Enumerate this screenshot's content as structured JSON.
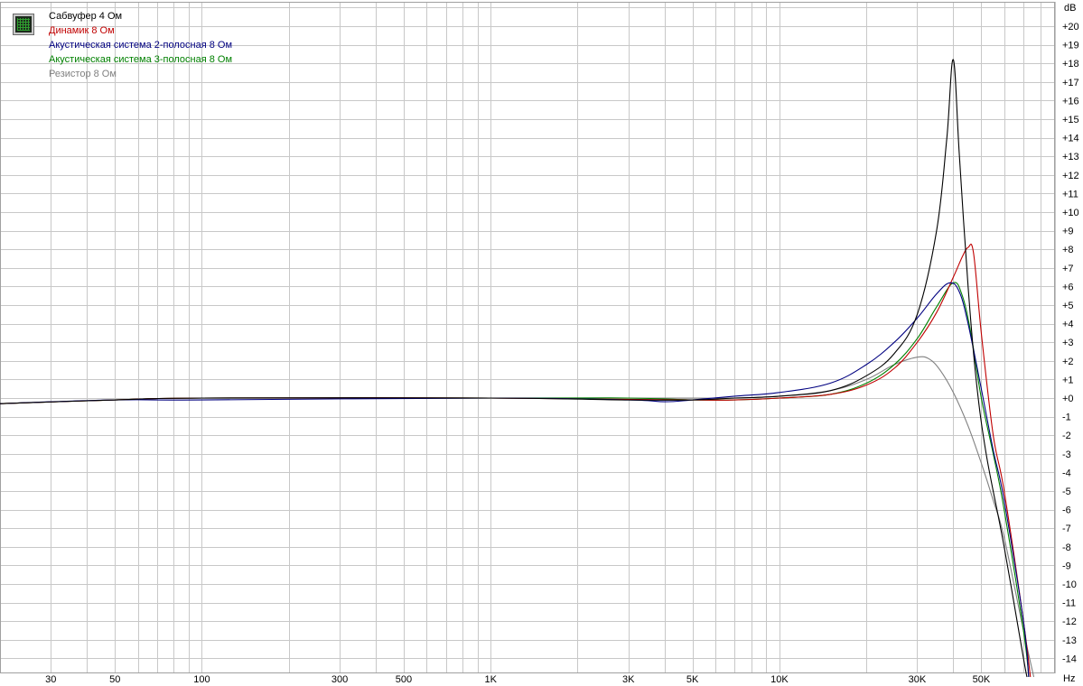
{
  "chart_data": {
    "type": "line",
    "title": "",
    "xlabel": "Hz",
    "ylabel": "dB",
    "x_scale": "log",
    "xlim": [
      20,
      90000
    ],
    "ylim": [
      -15,
      21
    ],
    "grid": true,
    "legend_position": "top-left",
    "x_ticks": [
      "30",
      "50",
      "100",
      "300",
      "500",
      "1K",
      "3K",
      "5K",
      "10K",
      "30K",
      "50K"
    ],
    "y_ticks": [
      "+20",
      "+19",
      "+18",
      "+17",
      "+16",
      "+15",
      "+14",
      "+13",
      "+12",
      "+11",
      "+10",
      "+9",
      "+8",
      "+7",
      "+6",
      "+5",
      "+4",
      "+3",
      "+2",
      "+1",
      "+0",
      "-1",
      "-2",
      "-3",
      "-4",
      "-5",
      "-6",
      "-7",
      "-8",
      "-9",
      "-10",
      "-11",
      "-12",
      "-13",
      "-14"
    ],
    "series": [
      {
        "name": "Сабвуфер 4 Ом",
        "color": "#000000",
        "points": [
          [
            20,
            -0.3
          ],
          [
            50,
            -0.1
          ],
          [
            100,
            0.0
          ],
          [
            1000,
            0.0
          ],
          [
            3000,
            -0.1
          ],
          [
            5000,
            -0.1
          ],
          [
            7000,
            0.0
          ],
          [
            10000,
            0.1
          ],
          [
            15000,
            0.4
          ],
          [
            20000,
            1.2
          ],
          [
            25000,
            2.4
          ],
          [
            30000,
            4.5
          ],
          [
            35000,
            9.0
          ],
          [
            38000,
            14.0
          ],
          [
            40000,
            18.2
          ],
          [
            42000,
            13.0
          ],
          [
            45000,
            6.0
          ],
          [
            48000,
            1.0
          ],
          [
            52000,
            -3.0
          ],
          [
            60000,
            -8.0
          ],
          [
            70000,
            -14.0
          ],
          [
            72000,
            -15.0
          ]
        ]
      },
      {
        "name": "Динамик 8 Ом",
        "color": "#c00000",
        "points": [
          [
            20,
            -0.3
          ],
          [
            50,
            -0.1
          ],
          [
            100,
            0.0
          ],
          [
            1000,
            0.0
          ],
          [
            5000,
            -0.1
          ],
          [
            7000,
            -0.1
          ],
          [
            10000,
            0.0
          ],
          [
            15000,
            0.2
          ],
          [
            20000,
            0.7
          ],
          [
            25000,
            1.6
          ],
          [
            30000,
            3.0
          ],
          [
            35000,
            4.6
          ],
          [
            40000,
            6.5
          ],
          [
            43000,
            7.6
          ],
          [
            45000,
            8.1
          ],
          [
            47000,
            7.8
          ],
          [
            50000,
            3.5
          ],
          [
            55000,
            -2.0
          ],
          [
            60000,
            -5.0
          ],
          [
            70000,
            -12.0
          ],
          [
            74000,
            -15.0
          ]
        ]
      },
      {
        "name": "Акустическая система 2-полосная 8 Ом",
        "color": "#000080",
        "points": [
          [
            20,
            -0.3
          ],
          [
            50,
            -0.1
          ],
          [
            100,
            -0.1
          ],
          [
            1000,
            0.0
          ],
          [
            3000,
            -0.1
          ],
          [
            4000,
            -0.2
          ],
          [
            5000,
            -0.1
          ],
          [
            7000,
            0.1
          ],
          [
            10000,
            0.3
          ],
          [
            15000,
            0.8
          ],
          [
            20000,
            1.8
          ],
          [
            25000,
            3.0
          ],
          [
            30000,
            4.3
          ],
          [
            35000,
            5.6
          ],
          [
            39000,
            6.2
          ],
          [
            42000,
            5.7
          ],
          [
            45000,
            4.0
          ],
          [
            50000,
            0.5
          ],
          [
            55000,
            -2.8
          ],
          [
            60000,
            -5.5
          ],
          [
            70000,
            -12.0
          ],
          [
            73000,
            -15.0
          ]
        ]
      },
      {
        "name": "Акустическая система 3-полосная 8 Ом",
        "color": "#008000",
        "points": [
          [
            20,
            -0.3
          ],
          [
            50,
            -0.1
          ],
          [
            100,
            0.0
          ],
          [
            1000,
            0.0
          ],
          [
            3000,
            0.0
          ],
          [
            5000,
            -0.1
          ],
          [
            7000,
            -0.1
          ],
          [
            10000,
            0.0
          ],
          [
            15000,
            0.2
          ],
          [
            20000,
            0.8
          ],
          [
            25000,
            1.8
          ],
          [
            30000,
            3.2
          ],
          [
            35000,
            4.9
          ],
          [
            40000,
            6.2
          ],
          [
            43000,
            5.5
          ],
          [
            46000,
            3.5
          ],
          [
            50000,
            0.0
          ],
          [
            55000,
            -3.0
          ],
          [
            60000,
            -6.0
          ],
          [
            70000,
            -12.5
          ],
          [
            73000,
            -15.0
          ]
        ]
      },
      {
        "name": "Резистор 8 Ом",
        "color": "#808080",
        "points": [
          [
            20,
            -0.3
          ],
          [
            50,
            -0.1
          ],
          [
            100,
            0.0
          ],
          [
            1000,
            0.0
          ],
          [
            5000,
            0.0
          ],
          [
            7000,
            0.0
          ],
          [
            10000,
            0.1
          ],
          [
            15000,
            0.4
          ],
          [
            20000,
            1.0
          ],
          [
            25000,
            1.8
          ],
          [
            30000,
            2.2
          ],
          [
            33000,
            2.1
          ],
          [
            36000,
            1.5
          ],
          [
            40000,
            0.3
          ],
          [
            45000,
            -1.5
          ],
          [
            50000,
            -3.5
          ],
          [
            55000,
            -5.5
          ],
          [
            60000,
            -7.5
          ],
          [
            70000,
            -12.5
          ],
          [
            76000,
            -15.0
          ]
        ]
      }
    ]
  }
}
